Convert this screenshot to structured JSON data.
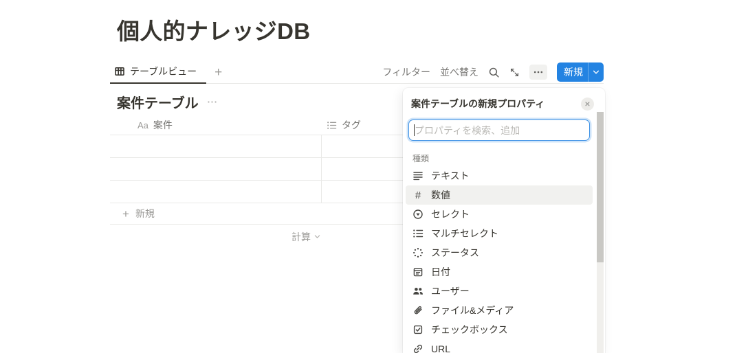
{
  "colors": {
    "accent": "#2383e2",
    "text": "#37352f",
    "muted": "#787774",
    "faint": "#9b9a97",
    "line": "#e9e9e7",
    "hover_bg": "#f1f1ef"
  },
  "page": {
    "title": "個人的ナレッジDB"
  },
  "tabbar": {
    "active_view": "テーブルビュー",
    "add_view": "+"
  },
  "toolbar": {
    "filter": "フィルター",
    "sort": "並べ替え",
    "new_button": "新規"
  },
  "table": {
    "title": "案件テーブル",
    "columns": [
      {
        "icon": "Aa",
        "label": "案件"
      },
      {
        "icon": "list-icon",
        "label": "タグ"
      }
    ],
    "empty_row_count": 3,
    "new_row": "新規",
    "calc_label": "計算"
  },
  "panel": {
    "title": "案件テーブルの新規プロパティ",
    "close": "×",
    "search_placeholder": "プロパティを検索、追加",
    "section_label": "種類",
    "items": [
      {
        "label": "テキスト",
        "highlighted": false
      },
      {
        "label": "数値",
        "highlighted": true
      },
      {
        "label": "セレクト",
        "highlighted": false
      },
      {
        "label": "マルチセレクト",
        "highlighted": false
      },
      {
        "label": "ステータス",
        "highlighted": false
      },
      {
        "label": "日付",
        "highlighted": false
      },
      {
        "label": "ユーザー",
        "highlighted": false
      },
      {
        "label": "ファイル&メディア",
        "highlighted": false
      },
      {
        "label": "チェックボックス",
        "highlighted": false
      },
      {
        "label": "URL",
        "highlighted": false
      }
    ]
  }
}
